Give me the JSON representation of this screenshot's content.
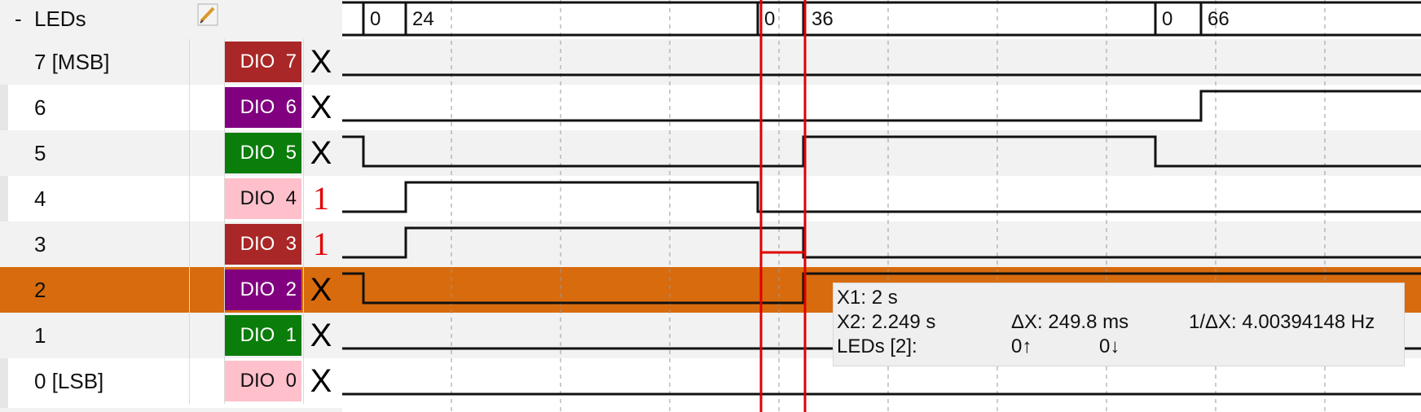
{
  "bus": {
    "collapse_symbol": "-",
    "name": "LEDs",
    "edit_icon": "pencil-edit-icon",
    "values": [
      "0",
      "24",
      "0",
      "36",
      "0",
      "66"
    ]
  },
  "channels": [
    {
      "name": "7 [MSB]",
      "dio": "DIO  7",
      "color": "#a92727",
      "text_color": "#ffffff",
      "state": "X"
    },
    {
      "name": "6",
      "dio": "DIO  6",
      "color": "#800080",
      "text_color": "#ffffff",
      "state": "X"
    },
    {
      "name": "5",
      "dio": "DIO  5",
      "color": "#0a7d0a",
      "text_color": "#ffffff",
      "state": "X"
    },
    {
      "name": "4",
      "dio": "DIO  4",
      "color": "#ffc0cb",
      "text_color": "#111111",
      "state": "1"
    },
    {
      "name": "3",
      "dio": "DIO  3",
      "color": "#a92727",
      "text_color": "#ffffff",
      "state": "1"
    },
    {
      "name": "2",
      "dio": "DIO  2",
      "color": "#800080",
      "text_color": "#ffffff",
      "state": "X"
    },
    {
      "name": "1",
      "dio": "DIO  1",
      "color": "#0a7d0a",
      "text_color": "#ffffff",
      "state": "X"
    },
    {
      "name": "0 [LSB]",
      "dio": "DIO  0",
      "color": "#ffc0cb",
      "text_color": "#111111",
      "state": "X"
    }
  ],
  "cursors": {
    "color": "#e00000",
    "x1_label": "X1: 2 s",
    "x2_label": "X2: 2.249 s",
    "dx_label": "ΔX: 249.8 ms",
    "freq_label": "1/ΔX: 4.00394148 Hz",
    "channel_label": "LEDs [2]:",
    "rising": "0↑",
    "falling": "0↓"
  },
  "colors": {
    "selected_row": "#d86b0d",
    "row_alt": "#f2f2f2",
    "trace": "#111111",
    "grid": "#9a9a9a"
  }
}
